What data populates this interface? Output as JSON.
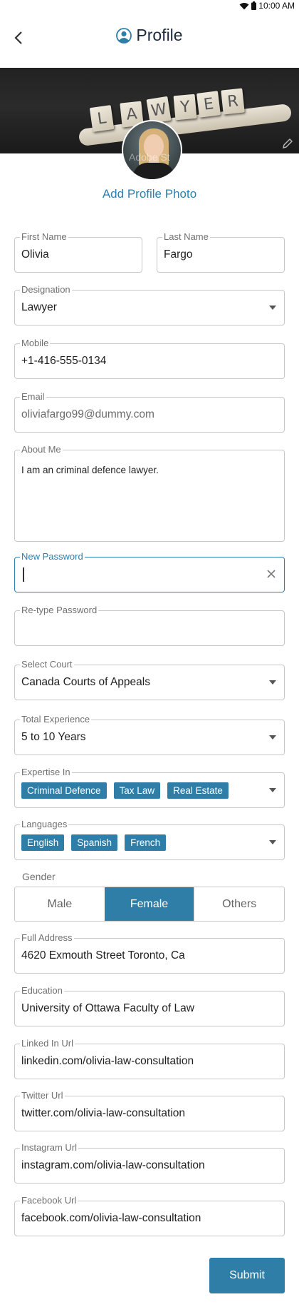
{
  "status_bar": {
    "time": "10:00 AM"
  },
  "app_bar": {
    "title": "Profile",
    "back_icon": "chevron-left-icon",
    "title_icon": "user-circle-icon"
  },
  "cover": {
    "tiles": [
      "L",
      "A",
      "W",
      "Y",
      "E",
      "R"
    ],
    "watermark": "Adobe St"
  },
  "add_photo_label": "Add Profile Photo",
  "form": {
    "first_name": {
      "label": "First Name",
      "value": "Olivia"
    },
    "last_name": {
      "label": "Last Name",
      "value": "Fargo"
    },
    "designation": {
      "label": "Designation",
      "value": "Lawyer"
    },
    "mobile": {
      "label": "Mobile",
      "value": "+1-416-555-0134"
    },
    "email": {
      "label": "Email",
      "value": "oliviafargo99@dummy.com"
    },
    "about": {
      "label": "About Me",
      "value": "I am an criminal defence lawyer."
    },
    "new_password": {
      "label": "New Password",
      "value": ""
    },
    "retype_password": {
      "label": "Re-type Password",
      "value": ""
    },
    "court": {
      "label": "Select Court",
      "value": "Canada Courts of Appeals"
    },
    "experience": {
      "label": "Total Experience",
      "value": "5 to 10 Years"
    },
    "expertise": {
      "label": "Expertise In",
      "chips": [
        "Criminal Defence",
        "Tax Law",
        "Real Estate"
      ]
    },
    "languages": {
      "label": "Languages",
      "chips": [
        "English",
        "Spanish",
        "French"
      ]
    },
    "gender": {
      "label": "Gender",
      "options": [
        "Male",
        "Female",
        "Others"
      ],
      "selected": "Female"
    },
    "address": {
      "label": "Full Address",
      "value": "4620  Exmouth Street Toronto, Ca"
    },
    "education": {
      "label": "Education",
      "value": "University of Ottawa Faculty of Law"
    },
    "linkedin": {
      "label": "Linked In Url",
      "value": "linkedin.com/olivia-law-consultation"
    },
    "twitter": {
      "label": "Twitter Url",
      "value": "twitter.com/olivia-law-consultation"
    },
    "instagram": {
      "label": "Instagram Url",
      "value": "instagram.com/olivia-law-consultation"
    },
    "facebook": {
      "label": "Facebook Url",
      "value": "facebook.com/olivia-law-consultation"
    }
  },
  "submit_label": "Submit",
  "colors": {
    "accent": "#2e7ea8",
    "title": "#1d2a3b",
    "border": "#c8c8c8",
    "link": "#2d7fb0"
  }
}
